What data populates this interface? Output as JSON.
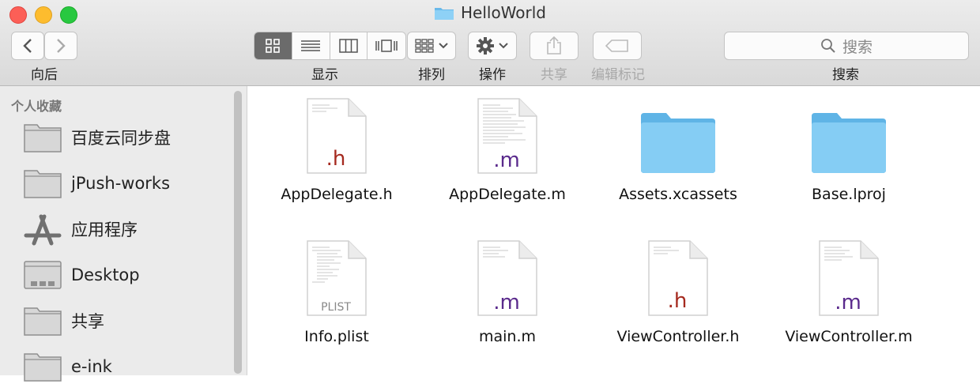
{
  "window": {
    "title": "HelloWorld"
  },
  "toolbar": {
    "back_label": "向后",
    "view_label": "显示",
    "arrange_label": "排列",
    "action_label": "操作",
    "share_label": "共享",
    "tags_label": "编辑标记",
    "search_label": "搜索",
    "search_placeholder": "搜索"
  },
  "sidebar": {
    "section": "个人收藏",
    "items": [
      {
        "label": "百度云同步盘",
        "icon": "folder-icon"
      },
      {
        "label": "jPush-works",
        "icon": "folder-icon"
      },
      {
        "label": "应用程序",
        "icon": "applications-icon"
      },
      {
        "label": "Desktop",
        "icon": "desktop-icon"
      },
      {
        "label": "共享",
        "icon": "folder-icon"
      },
      {
        "label": "e-ink",
        "icon": "folder-icon"
      }
    ]
  },
  "files": [
    {
      "name": "AppDelegate.h",
      "type": "doc",
      "ext": ".h",
      "ext_color": "#a52a1f"
    },
    {
      "name": "AppDelegate.m",
      "type": "doc",
      "ext": ".m",
      "ext_color": "#5a2a8c"
    },
    {
      "name": "Assets.xcassets",
      "type": "folder"
    },
    {
      "name": "Base.lproj",
      "type": "folder"
    },
    {
      "name": "Info.plist",
      "type": "doc",
      "ext": "PLIST",
      "ext_color": "#888888"
    },
    {
      "name": "main.m",
      "type": "doc",
      "ext": ".m",
      "ext_color": "#5a2a8c"
    },
    {
      "name": "ViewController.h",
      "type": "doc",
      "ext": ".h",
      "ext_color": "#a52a1f"
    },
    {
      "name": "ViewController.m",
      "type": "doc",
      "ext": ".m",
      "ext_color": "#5a2a8c"
    }
  ],
  "colors": {
    "folder": "#79c9f3",
    "accent": "#6b6b6b"
  }
}
